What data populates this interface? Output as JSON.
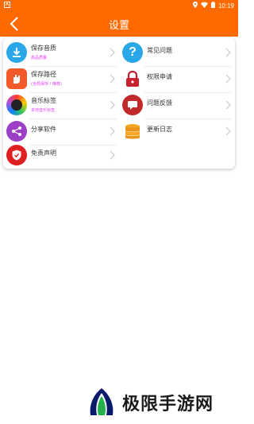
{
  "status": {
    "time": "10:19"
  },
  "header": {
    "title": "设置"
  },
  "menu": {
    "left": [
      {
        "label": "保存音质",
        "sub": "高品质量",
        "icon": "download-icon"
      },
      {
        "label": "保存路径",
        "sub": "(全局保存 / 推荐)",
        "icon": "hand-icon"
      },
      {
        "label": "音乐标签",
        "sub": "本地音乐标签",
        "icon": "music-ring-icon"
      },
      {
        "label": "分享软件",
        "sub": "",
        "icon": "share-icon"
      },
      {
        "label": "免责声明",
        "sub": "",
        "icon": "shield-icon"
      }
    ],
    "right": [
      {
        "label": "常见问题",
        "icon": "question-icon"
      },
      {
        "label": "权限申请",
        "icon": "lock-icon"
      },
      {
        "label": "问题反馈",
        "icon": "chat-icon"
      },
      {
        "label": "更新日志",
        "icon": "database-icon"
      }
    ]
  },
  "watermark": {
    "text": "极限手游网"
  },
  "colors": {
    "accent": "#ff6a00"
  }
}
